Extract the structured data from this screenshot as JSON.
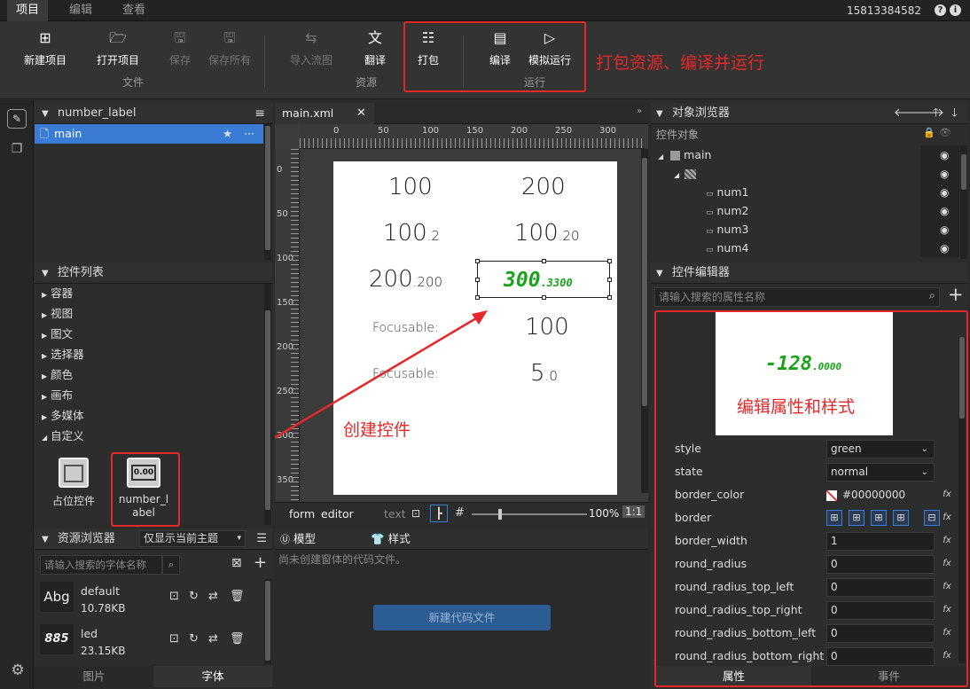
{
  "menu": {
    "tabs": [
      "项目",
      "编辑",
      "查看"
    ],
    "phone": "15813384582",
    "help_icon": "?",
    "info_icon": "i"
  },
  "toolbar": {
    "buttons": [
      {
        "label": "新建项目",
        "icon": "⊞"
      },
      {
        "label": "打开项目",
        "icon": "🗁"
      },
      {
        "label": "保存",
        "icon": "🖫"
      },
      {
        "label": "保存所有",
        "icon": "🖫"
      },
      {
        "label": "导入流图",
        "icon": "⇆"
      },
      {
        "label": "翻译",
        "icon": "文"
      },
      {
        "label": "打包",
        "icon": "☷"
      },
      {
        "label": "编译",
        "icon": "▤"
      },
      {
        "label": "模拟运行",
        "icon": "▷"
      }
    ],
    "groups": [
      "文件",
      "资源",
      "运行"
    ],
    "annotation": "打包资源、编译并运行"
  },
  "project_panel": {
    "title": "number_label",
    "item": "main"
  },
  "widget_list": {
    "title": "控件列表",
    "categories": [
      "容器",
      "视图",
      "图文",
      "选择器",
      "颜色",
      "画布",
      "多媒体",
      "自定义"
    ],
    "custom_items": [
      "占位控件",
      "number_label"
    ]
  },
  "resource_browser": {
    "title": "资源浏览器",
    "filter": "仅显示当前主题",
    "search_placeholder": "请输入搜索的字体名称",
    "fonts": [
      {
        "preview": "Abg",
        "name": "default",
        "size": "10.78KB"
      },
      {
        "preview": "885",
        "name": "led",
        "size": "23.15KB"
      }
    ],
    "tabs": [
      "图片",
      "字体"
    ]
  },
  "editor": {
    "tab": "main.xml",
    "ruler_h": [
      "0",
      "50",
      "100",
      "150",
      "200",
      "250",
      "300"
    ],
    "ruler_v": [
      "0",
      "50",
      "100",
      "150",
      "200",
      "250",
      "300",
      "350"
    ],
    "canvas_rows": [
      [
        "100",
        "200"
      ],
      [
        "100",
        ".2",
        "100",
        ".20"
      ],
      [
        "200",
        ".200",
        "300",
        ".3300"
      ],
      [
        "Focusable:",
        "100"
      ],
      [
        "Focusable:",
        "5",
        ".0"
      ]
    ],
    "bottom": {
      "form_label": "form",
      "editor_label": "editor",
      "text_label": "text",
      "zoom": "100%",
      "ratio": "1:1"
    },
    "annotation": "创建控件"
  },
  "code_panel": {
    "tab_model": "模型",
    "tab_style": "样式",
    "message": "尚未创建窗体的代码文件。",
    "button": "新建代码文件"
  },
  "object_browser": {
    "title": "对象浏览器",
    "subtitle": "控件对象",
    "nodes": [
      "main",
      "num1",
      "num2",
      "num3",
      "num4"
    ]
  },
  "widget_editor": {
    "title": "控件编辑器",
    "search_placeholder": "请输入搜索的属性名称",
    "preview_value": "-128",
    "preview_fraction": ".0000",
    "annotation": "编辑属性和样式",
    "props": [
      {
        "name": "style",
        "value": "green"
      },
      {
        "name": "state",
        "value": "normal"
      },
      {
        "name": "border_color",
        "value": "#00000000"
      },
      {
        "name": "border",
        "value": ""
      },
      {
        "name": "border_width",
        "value": "1"
      },
      {
        "name": "round_radius",
        "value": "0"
      },
      {
        "name": "round_radius_top_left",
        "value": "0"
      },
      {
        "name": "round_radius_top_right",
        "value": "0"
      },
      {
        "name": "round_radius_bottom_left",
        "value": "0"
      },
      {
        "name": "round_radius_bottom_right",
        "value": "0"
      }
    ],
    "tabs": [
      "属性",
      "事件"
    ]
  },
  "colors": {
    "accent": "#e5282a",
    "selected": "#3a7bd5",
    "led_green": "#1aa31a"
  }
}
